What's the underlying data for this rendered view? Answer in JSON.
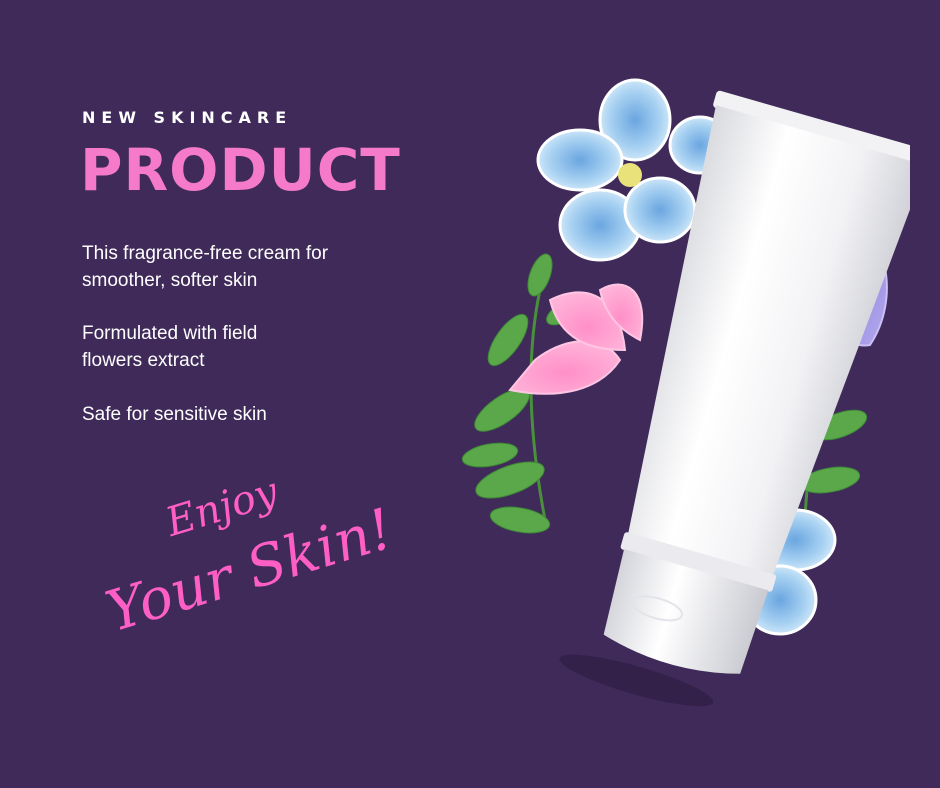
{
  "heading": {
    "eyebrow": "NEW SKINCARE",
    "title": "PRODUCT"
  },
  "features": [
    "This fragrance-free cream for\nsmoother, softer skin",
    "Formulated with field\nflowers extract",
    "Safe for sensitive skin"
  ],
  "tagline": {
    "line1": "Enjoy",
    "line2": "Your Skin!"
  },
  "colors": {
    "background": "#3f2a5a",
    "accent_pink": "#f57ac9",
    "script_pink": "#ff5fc4",
    "text": "#ffffff"
  },
  "illustration": {
    "subject": "white cream tube with blue, pink and purple flowers and green leaves"
  }
}
